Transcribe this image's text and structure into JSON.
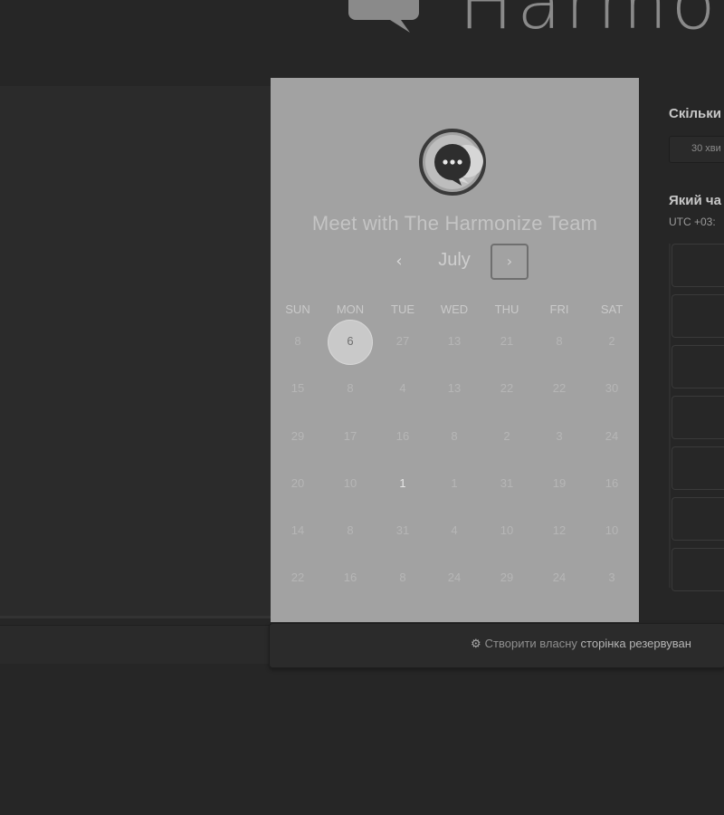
{
  "brand": {
    "name": "Harmonize",
    "icon": "chat-bubble-logo-icon"
  },
  "card": {
    "title": "Meet with The Harmonize Team",
    "avatar_icon": "chat-dots-icon",
    "month": "July",
    "prev_label": "‹",
    "next_label": "›",
    "weekdays": [
      "SUN",
      "MON",
      "TUE",
      "WED",
      "THU",
      "FRI",
      "SAT"
    ],
    "weeks": [
      [
        "8",
        "6",
        "27",
        "13",
        "21",
        "8",
        "2"
      ],
      [
        "15",
        "8",
        "4",
        "13",
        "22",
        "22",
        "30"
      ],
      [
        "29",
        "17",
        "16",
        "8",
        "2",
        "3",
        "24"
      ],
      [
        "20",
        "10",
        "1",
        "1",
        "31",
        "19",
        "16"
      ],
      [
        "14",
        "8",
        "31",
        "4",
        "10",
        "12",
        "10"
      ],
      [
        "22",
        "16",
        "8",
        "24",
        "29",
        "24",
        "3"
      ]
    ],
    "selected_day": "6"
  },
  "right": {
    "duration_question": "Скільки",
    "duration_value": "30 хви",
    "time_question": "Який ча",
    "timezone": "UTC +03:"
  },
  "footer": {
    "prefix": "Створити власну",
    "bold": "сторінка резервуван",
    "icon": "sprocket-icon"
  }
}
